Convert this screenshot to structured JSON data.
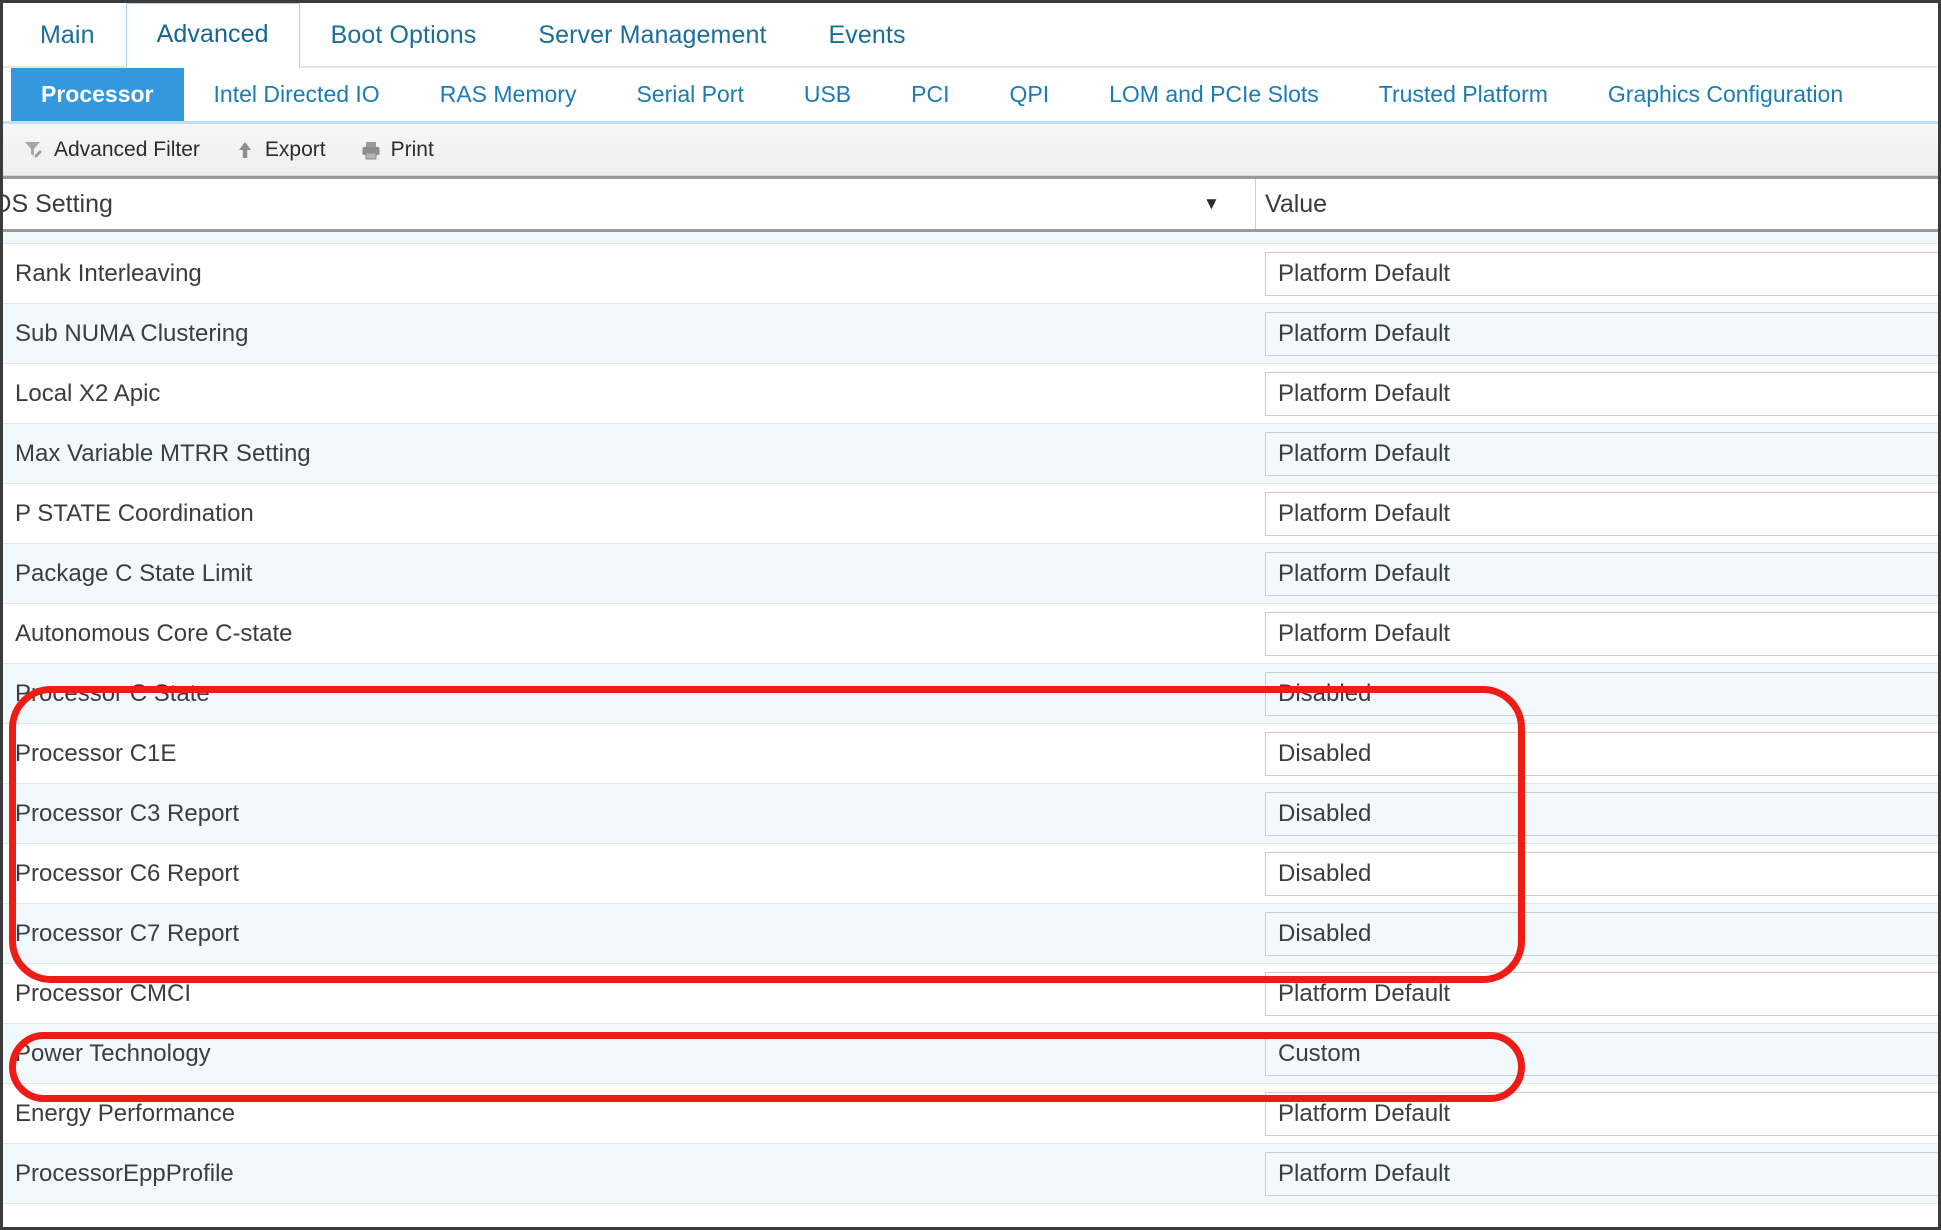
{
  "top_tabs": [
    {
      "label": "Main",
      "active": false
    },
    {
      "label": "Advanced",
      "active": true
    },
    {
      "label": "Boot Options",
      "active": false
    },
    {
      "label": "Server Management",
      "active": false
    },
    {
      "label": "Events",
      "active": false
    }
  ],
  "sub_tabs": [
    {
      "label": "Processor",
      "active": true
    },
    {
      "label": "Intel Directed IO",
      "active": false
    },
    {
      "label": "RAS Memory",
      "active": false
    },
    {
      "label": "Serial Port",
      "active": false
    },
    {
      "label": "USB",
      "active": false
    },
    {
      "label": "PCI",
      "active": false
    },
    {
      "label": "QPI",
      "active": false
    },
    {
      "label": "LOM and PCIe Slots",
      "active": false
    },
    {
      "label": "Trusted Platform",
      "active": false
    },
    {
      "label": "Graphics Configuration",
      "active": false
    }
  ],
  "toolbar": {
    "advanced_filter_label": "Advanced Filter",
    "advanced_filter_icon": "funnel-pencil-icon",
    "export_label": "Export",
    "export_icon": "up-arrow-icon",
    "print_label": "Print",
    "print_icon": "printer-icon"
  },
  "table": {
    "columns": {
      "setting_header": "OS Setting",
      "value_header": "Value",
      "sort_icon": "▼"
    },
    "rows": [
      {
        "setting": "Rank Interleaving",
        "value": "Platform Default",
        "highlighted": false
      },
      {
        "setting": "Sub NUMA Clustering",
        "value": "Platform Default",
        "highlighted": false
      },
      {
        "setting": "Local X2 Apic",
        "value": "Platform Default",
        "highlighted": false
      },
      {
        "setting": "Max Variable MTRR Setting",
        "value": "Platform Default",
        "highlighted": false
      },
      {
        "setting": "P STATE Coordination",
        "value": "Platform Default",
        "highlighted": false
      },
      {
        "setting": "Package C State Limit",
        "value": "Platform Default",
        "highlighted": false
      },
      {
        "setting": "Autonomous Core C-state",
        "value": "Platform Default",
        "highlighted": false
      },
      {
        "setting": "Processor C State",
        "value": "Disabled",
        "highlighted": true
      },
      {
        "setting": "Processor C1E",
        "value": "Disabled",
        "highlighted": true
      },
      {
        "setting": "Processor C3 Report",
        "value": "Disabled",
        "highlighted": true
      },
      {
        "setting": "Processor C6 Report",
        "value": "Disabled",
        "highlighted": true
      },
      {
        "setting": "Processor C7 Report",
        "value": "Disabled",
        "highlighted": true
      },
      {
        "setting": "Processor CMCI",
        "value": "Platform Default",
        "highlighted": false
      },
      {
        "setting": "Power Technology",
        "value": "Custom",
        "highlighted": true
      },
      {
        "setting": "Energy Performance",
        "value": "Platform Default",
        "highlighted": false
      },
      {
        "setting": "ProcessorEppProfile",
        "value": "Platform Default",
        "highlighted": false
      }
    ]
  },
  "annotations": [
    {
      "name": "c-state-group-highlight",
      "shape": "rounded-rectangle",
      "color": "#ee1c14"
    },
    {
      "name": "power-technology-highlight",
      "shape": "rounded-rectangle",
      "color": "#ee1c14"
    }
  ],
  "colors": {
    "accent_blue": "#3398dd",
    "tab_link_blue": "#1a7cb5",
    "highlight_red": "#ee1c14",
    "row_alt": "#f2f9fc"
  }
}
